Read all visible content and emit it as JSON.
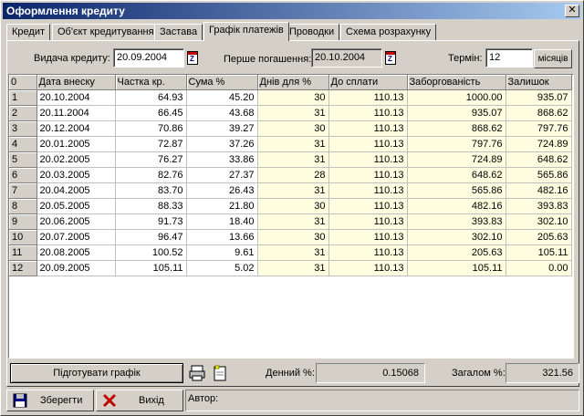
{
  "window": {
    "title": "Оформлення кредиту",
    "close_glyph": "✕"
  },
  "tabs": [
    {
      "label": "Кредит"
    },
    {
      "label": "Об'єкт кредитування"
    },
    {
      "label": "Застава"
    },
    {
      "label": "Графік платежів"
    },
    {
      "label": "Проводки"
    },
    {
      "label": "Схема розрахунку"
    }
  ],
  "form": {
    "issue_label": "Видача кредиту:",
    "issue_value": "20.09.2004",
    "first_label": "Перше погашення:",
    "first_value": "20.10.2004",
    "term_label": "Термін:",
    "term_value": "12",
    "term_unit": "місяців"
  },
  "table": {
    "headers": [
      "0",
      "Дата внеску",
      "Частка кр.",
      "Сума %",
      "Днів для %",
      "До сплати",
      "Заборгованість",
      "Залишок"
    ],
    "rows": [
      [
        "1",
        "20.10.2004",
        "64.93",
        "45.20",
        "30",
        "110.13",
        "1000.00",
        "935.07"
      ],
      [
        "2",
        "20.11.2004",
        "66.45",
        "43.68",
        "31",
        "110.13",
        "935.07",
        "868.62"
      ],
      [
        "3",
        "20.12.2004",
        "70.86",
        "39.27",
        "30",
        "110.13",
        "868.62",
        "797.76"
      ],
      [
        "4",
        "20.01.2005",
        "72.87",
        "37.26",
        "31",
        "110.13",
        "797.76",
        "724.89"
      ],
      [
        "5",
        "20.02.2005",
        "76.27",
        "33.86",
        "31",
        "110.13",
        "724.89",
        "648.62"
      ],
      [
        "6",
        "20.03.2005",
        "82.76",
        "27.37",
        "28",
        "110.13",
        "648.62",
        "565.86"
      ],
      [
        "7",
        "20.04.2005",
        "83.70",
        "26.43",
        "31",
        "110.13",
        "565.86",
        "482.16"
      ],
      [
        "8",
        "20.05.2005",
        "88.33",
        "21.80",
        "30",
        "110.13",
        "482.16",
        "393.83"
      ],
      [
        "9",
        "20.06.2005",
        "91.73",
        "18.40",
        "31",
        "110.13",
        "393.83",
        "302.10"
      ],
      [
        "10",
        "20.07.2005",
        "96.47",
        "13.66",
        "30",
        "110.13",
        "302.10",
        "205.63"
      ],
      [
        "11",
        "20.08.2005",
        "100.52",
        "9.61",
        "31",
        "110.13",
        "205.63",
        "105.11"
      ],
      [
        "12",
        "20.09.2005",
        "105.11",
        "5.02",
        "31",
        "110.13",
        "105.11",
        "0.00"
      ]
    ]
  },
  "footer": {
    "prepare_button": "Підготувати графік",
    "daily_label": "Денний %:",
    "daily_value": "0.15068",
    "total_label": "Загалом %:",
    "total_value": "321.56"
  },
  "bottom": {
    "save_button": "Зберегти",
    "exit_button": "Вихід",
    "author_label": "Автор:"
  },
  "colors": {
    "title_start": "#0a246a",
    "title_end": "#a6caf0",
    "highlight": "#fffde0"
  }
}
